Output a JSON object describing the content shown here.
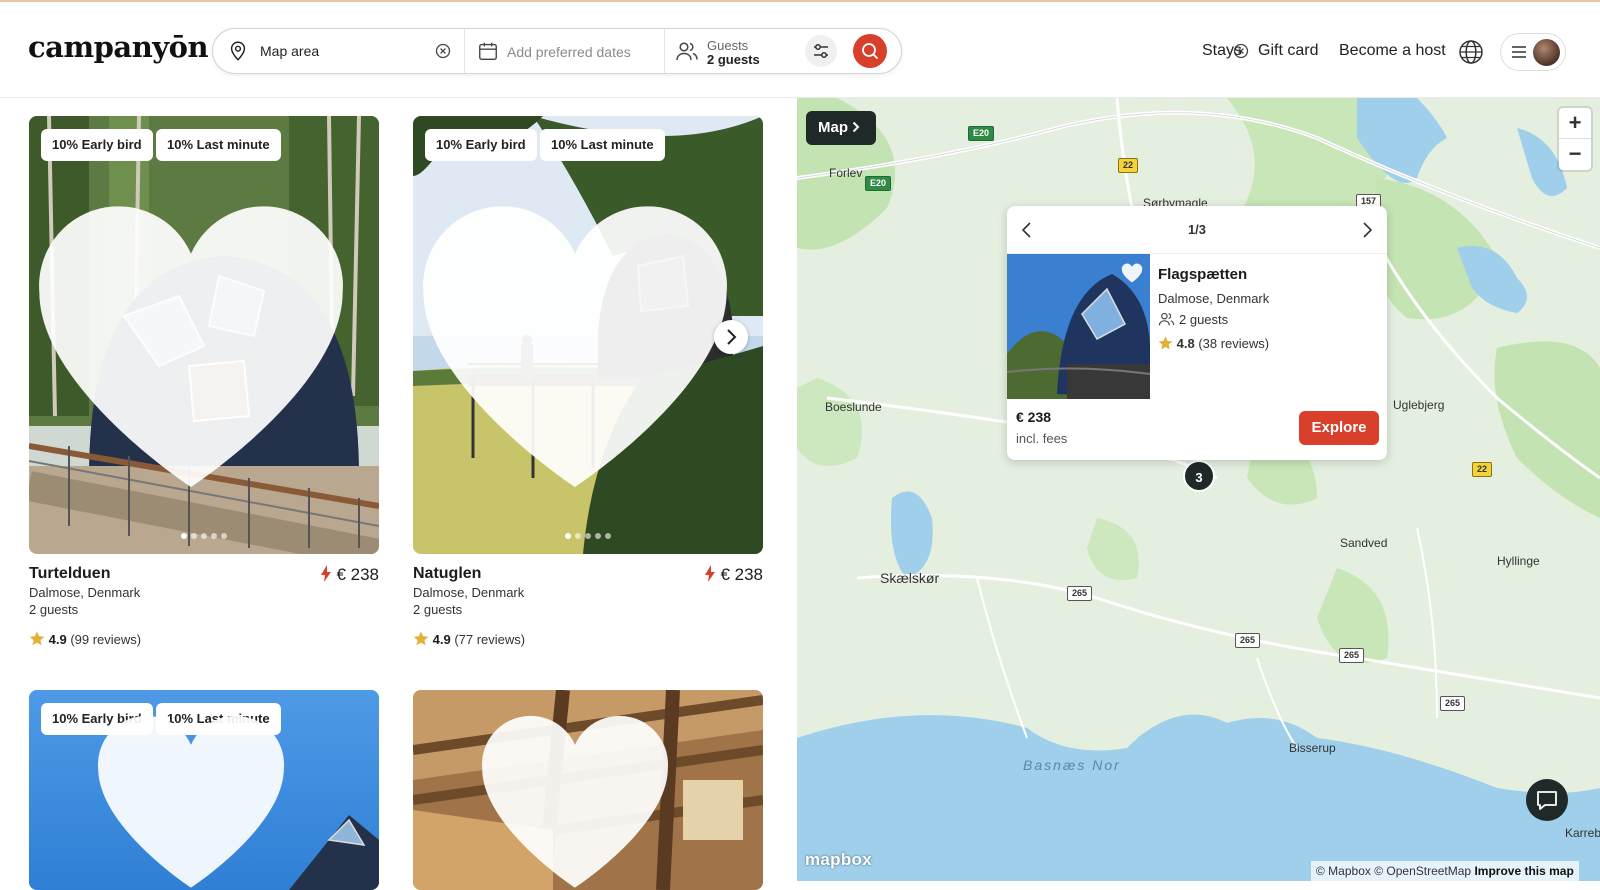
{
  "header": {
    "logo": "campanyōn",
    "search": {
      "area_value": "Map area",
      "dates_placeholder": "Add preferred dates",
      "guests_label": "Guests",
      "guests_value": "2 guests"
    },
    "nav": {
      "stays": "Stays",
      "gift_card": "Gift card",
      "become_host": "Become a host"
    }
  },
  "colors": {
    "accent": "#d8402b",
    "dark": "#1f2a28"
  },
  "listings": [
    {
      "badges": [
        "10% Early bird",
        "10% Last minute"
      ],
      "title": "Turtelduen",
      "price": "€ 238",
      "location": "Dalmose, Denmark",
      "guests": "2 guests",
      "rating": "4.9",
      "reviews": "(99 reviews)"
    },
    {
      "badges": [
        "10% Early bird",
        "10% Last minute"
      ],
      "title": "Natuglen",
      "price": "€ 238",
      "location": "Dalmose, Denmark",
      "guests": "2 guests",
      "rating": "4.9",
      "reviews": "(77 reviews)"
    },
    {
      "badges": [
        "10% Early bird",
        "10% Last minute"
      ]
    },
    {
      "badges": []
    }
  ],
  "map": {
    "toggle_label": "Map",
    "zoom_in": "+",
    "zoom_out": "−",
    "places": {
      "forlev": "Forlev",
      "sorbymagle": "Sørbymagle",
      "boeslunde": "Boeslunde",
      "uglebjerg": "Uglebjerg",
      "sandved": "Sandved",
      "hyllinge": "Hyllinge",
      "skaelskor": "Skælskør",
      "bisserup": "Bisserup",
      "karrebaek": "Karreb",
      "basnaes_nor": "Basnæs Nor"
    },
    "roads": {
      "e20": "E20",
      "r22": "22",
      "r157": "157",
      "r265": "265"
    },
    "cluster_count": "3",
    "popup": {
      "counter": "1/3",
      "title": "Flagspætten",
      "location": "Dalmose, Denmark",
      "guests": "2 guests",
      "rating": "4.8",
      "reviews": "(38 reviews)",
      "price": "€ 238",
      "fees": "incl. fees",
      "explore": "Explore"
    },
    "logo": "mapbox",
    "attribution": {
      "mapbox": "© Mapbox",
      "osm": "© OpenStreetMap",
      "improve": "Improve this map"
    }
  },
  "icons": [
    "location-pin-icon",
    "clear-icon",
    "calendar-icon",
    "guests-icon",
    "filter-icon",
    "search-icon",
    "globe-icon",
    "hamburger-menu-icon",
    "heart-icon",
    "chevron-right-icon",
    "chevron-left-icon",
    "star-icon",
    "lightning-icon",
    "chat-icon"
  ]
}
